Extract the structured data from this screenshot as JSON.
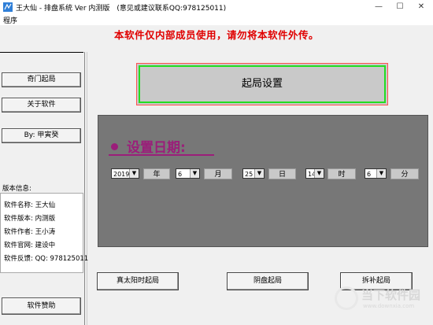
{
  "window": {
    "title": "王大仙 - 排盘系统 Ver 内测版　(意见或建议联系QQ:978125011)",
    "minimize_glyph": "—",
    "maximize_glyph": "☐",
    "close_glyph": "✕"
  },
  "menu": {
    "items": [
      "程序"
    ]
  },
  "banner": "本软件仅内部成员使用，请勿将本软件外传。",
  "sidebar": {
    "buttons": [
      "奇门起局",
      "关于软件",
      "By: 甲寅癸"
    ],
    "info_title": "版本信息:",
    "info_lines": [
      "软件名称: 王大仙",
      "软件版本: 内测版",
      "软件作者: 王小涛",
      "软件官网: 建设中",
      "软件反馈: QQ: 978125011"
    ],
    "bottom_button": "软件赞助"
  },
  "header": {
    "label": "起局设置"
  },
  "date_panel": {
    "title": "设置日期:",
    "year": "2019",
    "year_unit": "年",
    "month": "6",
    "month_unit": "月",
    "day": "25",
    "day_unit": "日",
    "hour": "14",
    "hour_unit": "时",
    "minute": "6",
    "minute_unit": "分"
  },
  "actions": [
    "真太阳时起局",
    "阴盘起局",
    "拆补起局"
  ],
  "watermark": {
    "text": "当下软件园",
    "sub": "www.downxia.com"
  },
  "colors": {
    "banner": "#e00000",
    "accent": "#9b1e7a",
    "panel": "#777777",
    "highlight_border": "#22dd22"
  }
}
